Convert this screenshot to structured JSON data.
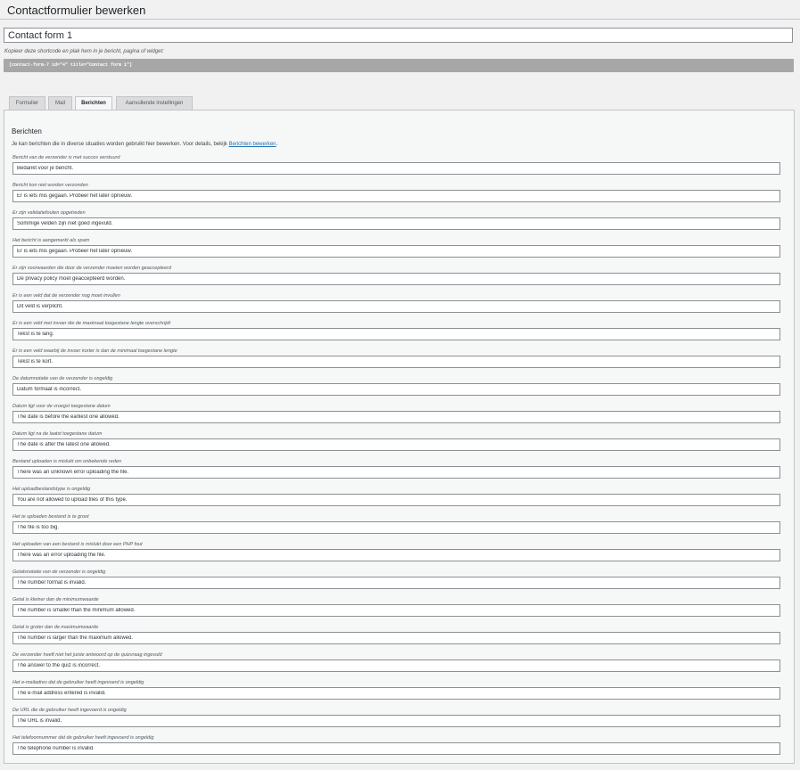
{
  "page": {
    "title": "Contactformulier bewerken"
  },
  "form": {
    "title_value": "Contact form 1",
    "shortcode_hint": "Kopieer deze shortcode en plak hem in je bericht, pagina of widget:",
    "shortcode": "[contact-form-7 id=\"4\" title=\"Contact form 1\"]"
  },
  "tabs": [
    {
      "label": "Formulier",
      "active": false
    },
    {
      "label": "Mail",
      "active": false
    },
    {
      "label": "Berichten",
      "active": true
    },
    {
      "label": "Aanvullende instellingen",
      "active": false
    }
  ],
  "messages": {
    "heading": "Berichten",
    "description": "Je kan berichten die in diverse situaties worden gebruikt hier bewerken. Voor details, bekijk ",
    "description_link": "Berichten bewerken",
    "description_end": ".",
    "items": [
      {
        "label": "Bericht van de verzender is met succes verstuurd",
        "value": "Bedankt voor je bericht."
      },
      {
        "label": "Bericht kon niet worden verzonden",
        "value": "Er is iets mis gegaan. Probeer het later opnieuw."
      },
      {
        "label": "Er zijn validatiefouten opgetreden",
        "value": "Sommige velden zijn niet goed ingevuld."
      },
      {
        "label": "Het bericht is aangemerkt als spam",
        "value": "Er is iets mis gegaan. Probeer het later opnieuw."
      },
      {
        "label": "Er zijn voorwaarden die door de verzender moeten worden geaccepteerd",
        "value": "De privacy policy moet geaccepteerd worden."
      },
      {
        "label": "Er is een veld dat de verzender nog moet invullen",
        "value": "Dit veld is verplicht."
      },
      {
        "label": "Er is een veld met invoer die de maximaal toegestane lengte overschrijdt",
        "value": "Tekst is te lang."
      },
      {
        "label": "Er is een veld waarbij de invoer korter is dan de minimaal toegestane lengte",
        "value": "Tekst is te kort."
      },
      {
        "label": "De datumnotatie van de verzender is ongeldig",
        "value": "Datum formaat is incorrect."
      },
      {
        "label": "Datum ligt voor de vroegst toegestane datum",
        "value": "The date is before the earliest one allowed."
      },
      {
        "label": "Datum ligt na de laatst toegestane datum",
        "value": "The date is after the latest one allowed."
      },
      {
        "label": "Bestand uploaden is mislukt om onbekende reden",
        "value": "There was an unknown error uploading the file."
      },
      {
        "label": "Het uploadbestandstype is ongeldig",
        "value": "You are not allowed to upload files of this type."
      },
      {
        "label": "Het te uploaden bestand is te groot",
        "value": "The file is too big."
      },
      {
        "label": "Het uploaden van een bestand is mislukt door een PHP fout",
        "value": "There was an error uploading the file."
      },
      {
        "label": "Getalsnotatie van de verzender is ongeldig",
        "value": "The number format is invalid."
      },
      {
        "label": "Getal is kleiner dan de minimumwaarde",
        "value": "The number is smaller than the minimum allowed."
      },
      {
        "label": "Getal is groter dan de maximumwaarde",
        "value": "The number is larger than the maximum allowed."
      },
      {
        "label": "De verzender heeft niet het juiste antwoord op de quizvraag ingevuld",
        "value": "The answer to the quiz is incorrect."
      },
      {
        "label": "Het e-mailadres dat de gebruiker heeft ingevoerd is ongeldig",
        "value": "The e-mail address entered is invalid."
      },
      {
        "label": "De URL die de gebruiker heeft ingevoerd is ongeldig",
        "value": "The URL is invalid."
      },
      {
        "label": "Het telefoonnummer dat de gebruiker heeft ingevoerd is ongeldig",
        "value": "The telephone number is invalid."
      }
    ]
  }
}
